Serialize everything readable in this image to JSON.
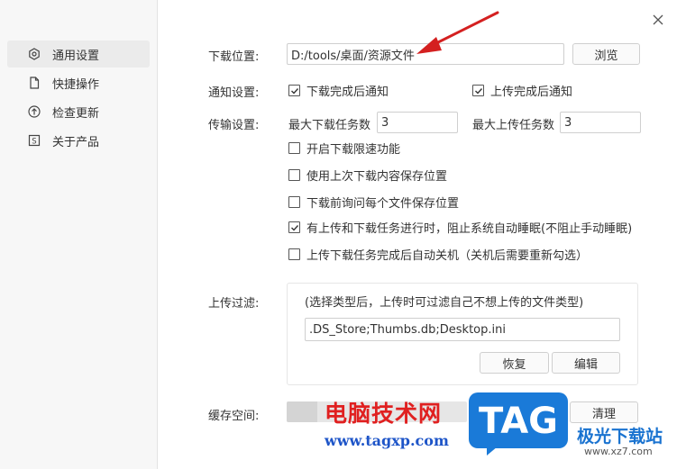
{
  "sidebar": {
    "items": [
      {
        "label": "通用设置",
        "icon": "settings-hex-icon",
        "active": true
      },
      {
        "label": "快捷操作",
        "icon": "document-icon",
        "active": false
      },
      {
        "label": "检查更新",
        "icon": "upload-circle-icon",
        "active": false
      },
      {
        "label": "关于产品",
        "icon": "info-square-icon",
        "active": false
      }
    ]
  },
  "download": {
    "label": "下载位置:",
    "path": "D:/tools/桌面/资源文件",
    "browse_label": "浏览"
  },
  "notify": {
    "label": "通知设置:",
    "download_done": "下载完成后通知",
    "upload_done": "上传完成后通知"
  },
  "transfer": {
    "label": "传输设置:",
    "max_download_label": "最大下载任务数",
    "max_download_value": "3",
    "max_upload_label": "最大上传任务数",
    "max_upload_value": "3",
    "options": [
      {
        "label": "开启下载限速功能",
        "checked": false
      },
      {
        "label": "使用上次下载内容保存位置",
        "checked": false
      },
      {
        "label": "下载前询问每个文件保存位置",
        "checked": false
      },
      {
        "label": "有上传和下载任务进行时，阻止系统自动睡眠(不阻止手动睡眠)",
        "checked": true
      },
      {
        "label": "上传下载任务完成后自动关机（关机后需要重新勾选）",
        "checked": false
      }
    ]
  },
  "upload_filter": {
    "label": "上传过滤:",
    "hint": "(选择类型后，上传时可过滤自己不想上传的文件类型)",
    "value": ".DS_Store;Thumbs.db;Desktop.ini",
    "restore_label": "恢复",
    "edit_label": "编辑"
  },
  "cache": {
    "label": "缓存空间:",
    "clear_label": "清理",
    "used_fraction": 0.17
  },
  "watermark": {
    "cn_text": "电脑技术网",
    "url": "www.tagxp.com",
    "logo_text": "TAG",
    "site_cn": "极光下载站",
    "site_url": "www.xz7.com"
  },
  "colors": {
    "arrow": "#d42020",
    "watermark_red": "#e02020",
    "watermark_blue": "#1e55c8",
    "logo_blue": "#1a7ad8"
  }
}
